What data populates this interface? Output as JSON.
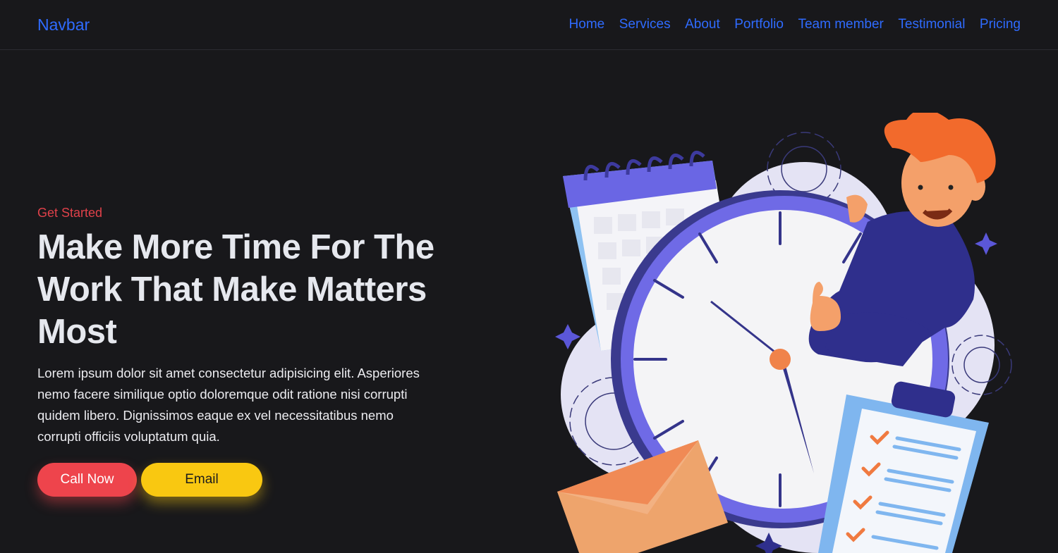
{
  "navbar": {
    "brand": "Navbar",
    "links": [
      "Home",
      "Services",
      "About",
      "Portfolio",
      "Team member",
      "Testimonial",
      "Pricing"
    ]
  },
  "hero": {
    "eyebrow": "Get Started",
    "headline": "Make More Time For The Work That Make Matters Most",
    "description": "Lorem ipsum dolor sit amet consectetur adipisicing elit. Asperiores nemo facere similique optio doloremque odit ratione nisi corrupti quidem libero. Dignissimos eaque ex vel necessitatibus nemo corrupti officiis voluptatum quia.",
    "call_label": "Call Now",
    "email_label": "Email"
  },
  "colors": {
    "background": "#18181b",
    "link": "#2f6bff",
    "accent_red": "#ee444c",
    "accent_yellow": "#f9c811"
  },
  "illustration": {
    "icon": "time-management-illustration"
  }
}
